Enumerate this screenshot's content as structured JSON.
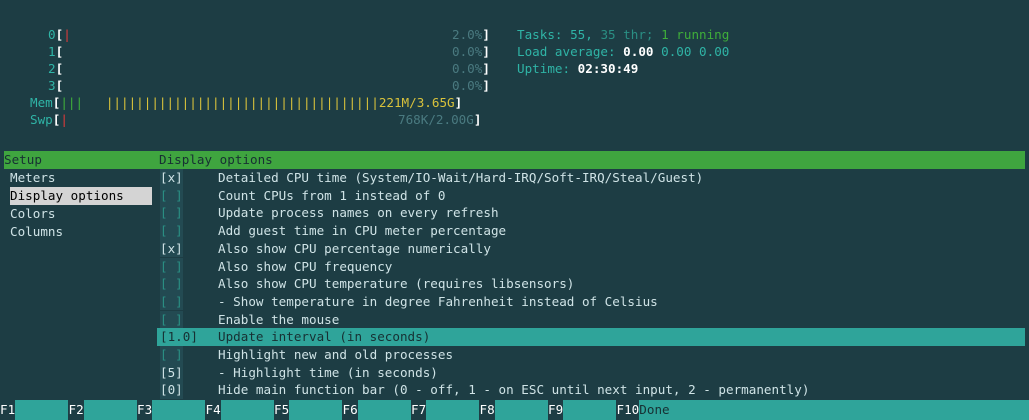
{
  "header": {
    "cpus": [
      {
        "label": "0",
        "pct": "2.0%",
        "usage": 0.02
      },
      {
        "label": "1",
        "pct": "0.0%",
        "usage": 0.0
      },
      {
        "label": "2",
        "pct": "0.0%",
        "usage": 0.0
      },
      {
        "label": "3",
        "pct": "0.0%",
        "usage": 0.0
      }
    ],
    "mem": {
      "label": "Mem",
      "value": "221M/3.65G"
    },
    "swp": {
      "label": "Swp",
      "value": "768K/2.00G"
    },
    "tasks_label": "Tasks:",
    "tasks_count": "55,",
    "threads": "35 thr;",
    "running": "1 running",
    "load_label": "Load average:",
    "load_1": "0.00",
    "load_5": "0.00",
    "load_15": "0.00",
    "uptime_label": "Uptime:",
    "uptime": "02:30:49"
  },
  "sidebar": {
    "items": [
      {
        "label": "Setup"
      },
      {
        "label": "Meters"
      },
      {
        "label": "Display options"
      },
      {
        "label": "Colors"
      },
      {
        "label": "Columns"
      }
    ]
  },
  "panel": {
    "title": "Display options",
    "options": [
      {
        "box": "[x]",
        "label": "Detailed CPU time (System/IO-Wait/Hard-IRQ/Soft-IRQ/Steal/Guest)"
      },
      {
        "box": "[ ]",
        "label": "Count CPUs from 1 instead of 0"
      },
      {
        "box": "[ ]",
        "label": "Update process names on every refresh"
      },
      {
        "box": "[ ]",
        "label": "Add guest time in CPU meter percentage"
      },
      {
        "box": "[x]",
        "label": "Also show CPU percentage numerically"
      },
      {
        "box": "[ ]",
        "label": "Also show CPU frequency"
      },
      {
        "box": "[ ]",
        "label": "Also show CPU temperature (requires libsensors)"
      },
      {
        "box": "[ ]",
        "label": "- Show temperature in degree Fahrenheit instead of Celsius"
      },
      {
        "box": "[ ]",
        "label": "Enable the mouse"
      },
      {
        "box": "[1.0]",
        "label": "Update interval (in seconds)"
      },
      {
        "box": "[ ]",
        "label": "Highlight new and old processes"
      },
      {
        "box": "[5]",
        "label": "- Highlight time (in seconds)"
      },
      {
        "box": "[0]",
        "label": "Hide main function bar (0 - off, 1 - on ESC until next input, 2 - permanently)"
      }
    ]
  },
  "footer": {
    "keys": [
      {
        "key": "F1",
        "label": ""
      },
      {
        "key": "F2",
        "label": ""
      },
      {
        "key": "F3",
        "label": ""
      },
      {
        "key": "F4",
        "label": ""
      },
      {
        "key": "F5",
        "label": ""
      },
      {
        "key": "F6",
        "label": ""
      },
      {
        "key": "F7",
        "label": ""
      },
      {
        "key": "F8",
        "label": ""
      },
      {
        "key": "F9",
        "label": ""
      },
      {
        "key": "F10",
        "label": "Done"
      }
    ]
  },
  "colors": {
    "background": "#1d3d44",
    "header_bar": "#3fa53f",
    "selection": "#2fa49a",
    "sidebar_selected": "#d4d4d4"
  }
}
